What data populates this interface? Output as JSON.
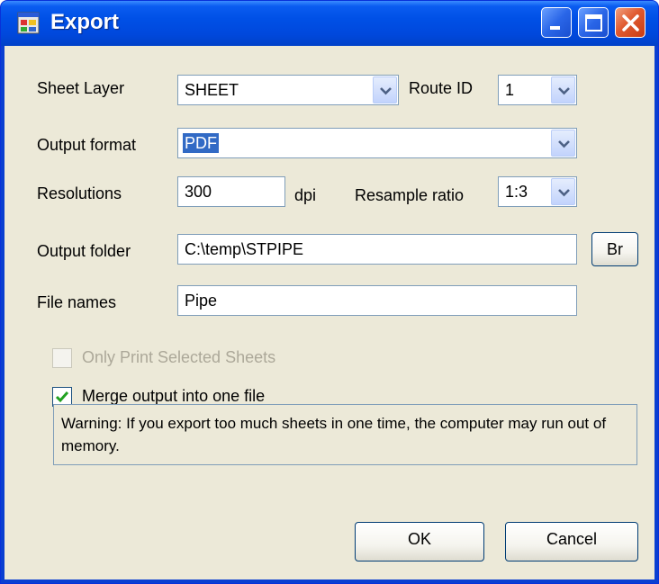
{
  "window": {
    "title": "Export",
    "icon": "export-app-icon"
  },
  "titlebar_buttons": {
    "minimize": "minimize-icon",
    "maximize": "maximize-icon",
    "close": "close-icon"
  },
  "form": {
    "sheet_layer": {
      "label": "Sheet Layer",
      "value": "SHEET"
    },
    "route_id": {
      "label": "Route ID",
      "value": "1"
    },
    "output_format": {
      "label": "Output format",
      "value": "PDF"
    },
    "resolutions": {
      "label": "Resolutions",
      "value": "300",
      "unit": "dpi"
    },
    "resample_ratio": {
      "label": "Resample ratio",
      "value": "1:3"
    },
    "output_folder": {
      "label": "Output folder",
      "value": "C:\\temp\\STPIPE",
      "browse_label": "Br"
    },
    "file_names": {
      "label": "File names",
      "value": "Pipe"
    },
    "only_print_selected": {
      "label": "Only Print Selected Sheets",
      "checked": false,
      "enabled": false
    },
    "merge_output": {
      "label": "Merge output into one file",
      "checked": true,
      "enabled": true
    },
    "warning": "Warning: If you export too much sheets in one time, the computer may run out of memory."
  },
  "buttons": {
    "ok": "OK",
    "cancel": "Cancel"
  },
  "colors": {
    "titlebar": "#0050e6",
    "dialog_bg": "#ece9d8",
    "selection": "#316ac5",
    "check_green": "#21a121"
  }
}
